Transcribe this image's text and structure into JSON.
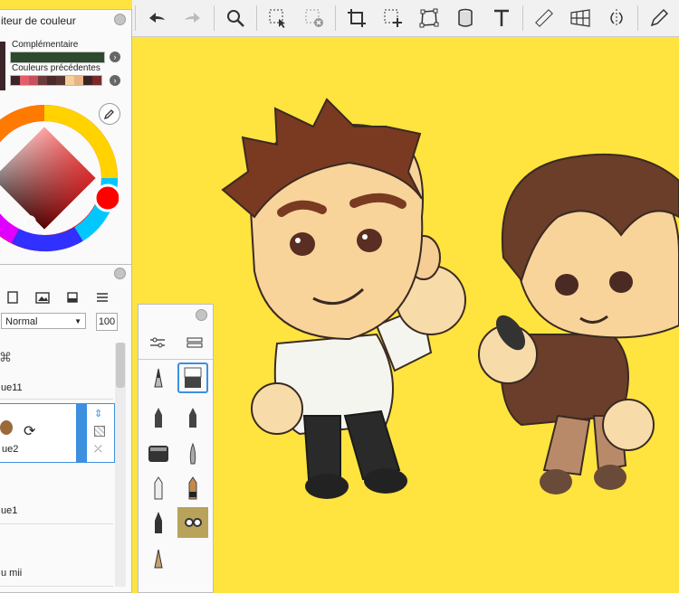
{
  "color_panel": {
    "title": "iteur de couleur",
    "complementary_label": "Complémentaire",
    "previous_colors_label": "Couleurs précédentes",
    "main_color": "#3b2528",
    "complementary_color": "#2e4a2e",
    "current_color": "#ff0000",
    "previous_colors": [
      "#3b2528",
      "#e35d6a",
      "#c7505a",
      "#6b3a3a",
      "#4a2a2a",
      "#5a3430",
      "#f2d19b",
      "#e8b485",
      "#3d2424",
      "#7a2a2a"
    ]
  },
  "layer_panel": {
    "blend_mode": "Normal",
    "opacity": "100",
    "layers": [
      {
        "name": "ue11"
      },
      {
        "name": "ue2"
      },
      {
        "name": "ue1"
      },
      {
        "name": "u mii"
      }
    ]
  },
  "toolbar": {
    "icons": [
      "undo-icon",
      "redo-icon",
      "zoom-icon",
      "select-icon",
      "deselect-icon",
      "crop-icon",
      "transform-icon",
      "free-transform-icon",
      "fill-icon",
      "text-icon",
      "ruler-icon",
      "perspective-icon",
      "symmetry-icon",
      "pen-icon"
    ]
  },
  "brush_panel": {
    "tools": [
      "pen",
      "eraser",
      "ink-pen",
      "fine-pen",
      "marker",
      "brush",
      "pencil",
      "hr-pencil",
      "airbrush",
      "custom-brush",
      "nib"
    ]
  },
  "colors": {
    "canvas": "#ffe33f",
    "selection": "#3d8fe0"
  }
}
